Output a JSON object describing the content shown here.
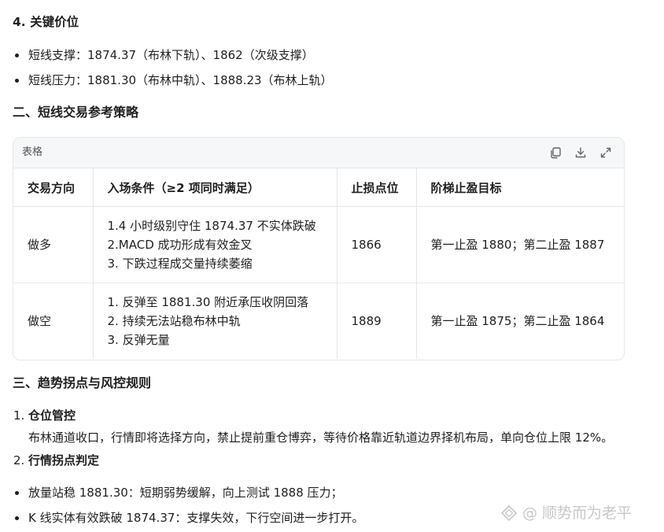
{
  "section4": {
    "title": "4. 关键价位",
    "bullets": [
      "短线支撑：1874.37（布林下轨）、1862（次级支撑）",
      "短线压力：1881.30（布林中轨）、1888.23（布林上轨）"
    ]
  },
  "section2": {
    "title": "二、短线交易参考策略"
  },
  "table": {
    "label": "表格",
    "tools": [
      "copy-icon",
      "download-icon",
      "expand-icon"
    ],
    "headers": [
      "交易方向",
      "入场条件（≥2 项同时满足）",
      "止损点位",
      "阶梯止盈目标"
    ],
    "rows": [
      {
        "direction": "做多",
        "conditions": [
          "1.4 小时级别守住 1874.37 不实体跌破",
          "2.MACD 成功形成有效金叉",
          "3. 下跌过程成交量持续萎缩"
        ],
        "stop": "1866",
        "target": "第一止盈 1880；第二止盈 1887"
      },
      {
        "direction": "做空",
        "conditions": [
          "1. 反弹至 1881.30 附近承压收阴回落",
          "2. 持续无法站稳布林中轨",
          "3. 反弹无量"
        ],
        "stop": "1889",
        "target": "第一止盈 1875；第二止盈 1864"
      }
    ]
  },
  "section3": {
    "title": "三、趋势拐点与风控规则",
    "items": [
      {
        "num": "1.",
        "title": "仓位管控",
        "text": "布林通道收口，行情即将选择方向，禁止提前重仓博弈，等待价格靠近轨道边界择机布局，单向仓位上限 12%。"
      },
      {
        "num": "2.",
        "title": "行情拐点判定"
      }
    ],
    "bullets": [
      "放量站稳 1881.30：短期弱势缓解，向上测试 1888 压力；",
      "K 线实体有效跌破 1874.37：支撑失效，下行空间进一步打开。"
    ]
  },
  "watermark": {
    "text": "@ 顺势而为老平",
    "icon": "logo-icon"
  },
  "colors": {
    "text": "#1f1f1f",
    "border": "#e6e7ea",
    "header_bg": "#f6f7f9",
    "muted": "#555555",
    "watermark": "#c8c8c8"
  }
}
